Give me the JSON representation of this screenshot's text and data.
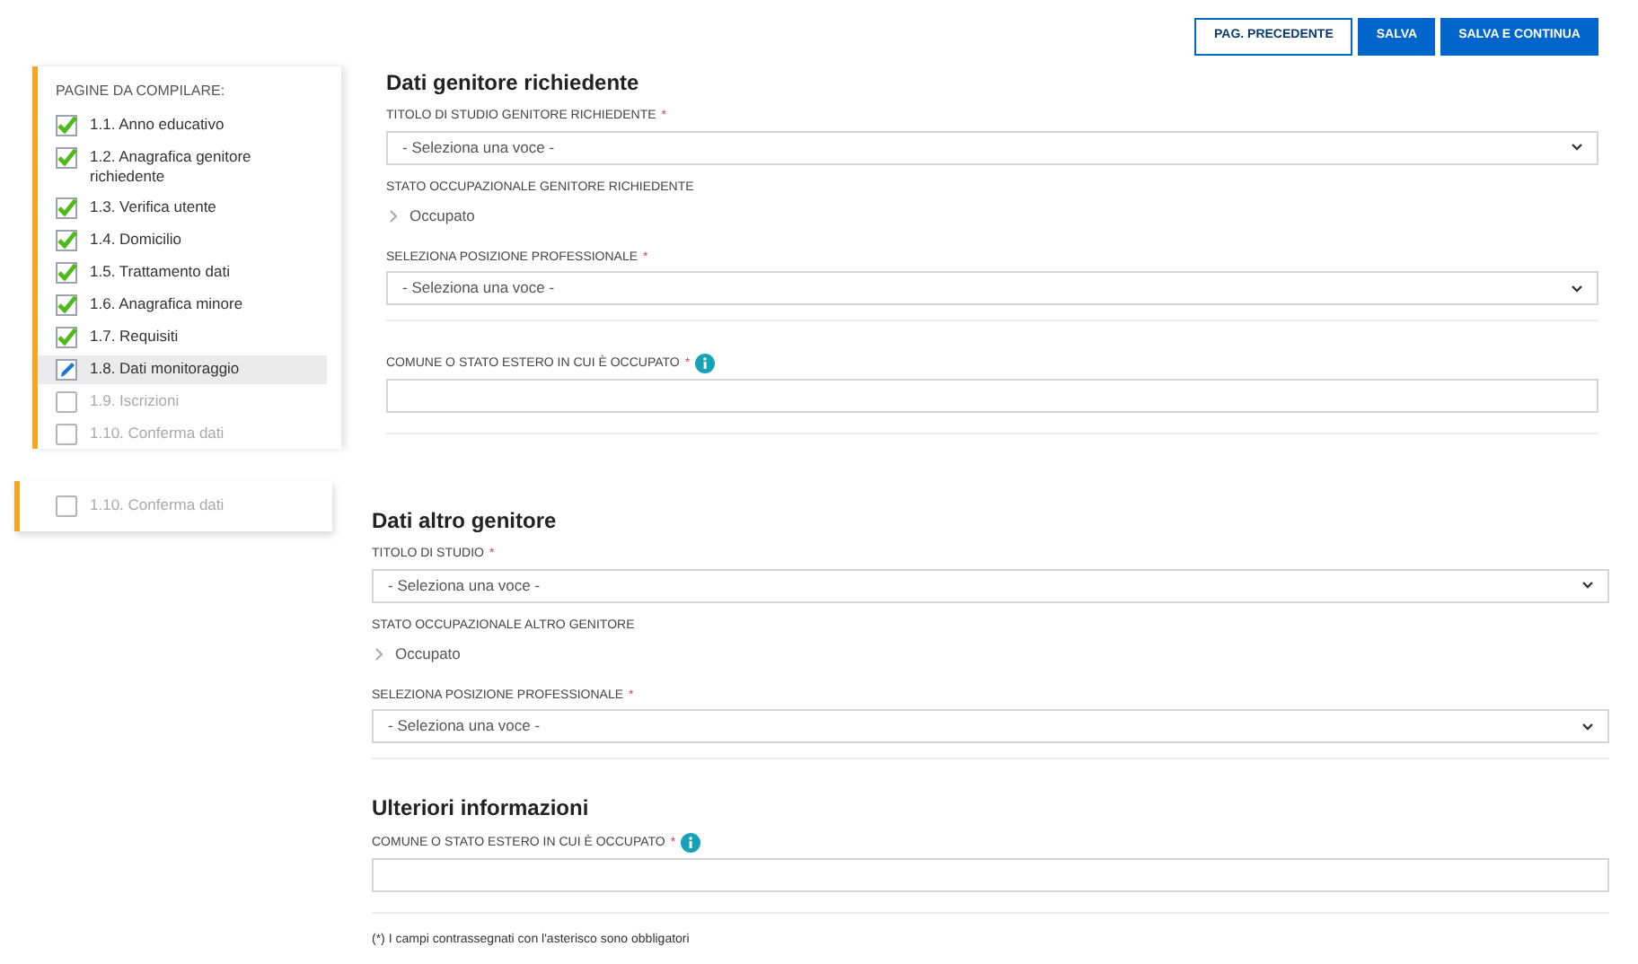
{
  "buttons": [
    {
      "label": "PAG. PRECEDENTE",
      "kind": "outline"
    },
    {
      "label": "SALVA",
      "kind": "primary"
    },
    {
      "label": "SALVA E CONTINUA",
      "kind": "primary"
    }
  ],
  "sidebar": {
    "title": "PAGINE DA COMPILARE:",
    "items": [
      {
        "label": "1.1. Anno educativo",
        "checked": true,
        "selected": false
      },
      {
        "label": "1.2. Anagrafica genitore richiedente",
        "checked": true,
        "selected": false
      },
      {
        "label": "1.3. Verifica utente",
        "checked": true,
        "selected": false
      },
      {
        "label": "1.4. Domicilio",
        "checked": true,
        "selected": false
      },
      {
        "label": "1.5. Trattamento dati",
        "checked": true,
        "selected": false
      },
      {
        "label": "1.6. Anagrafica minore",
        "checked": true,
        "selected": false
      },
      {
        "label": "1.7. Requisiti",
        "checked": true,
        "selected": false
      },
      {
        "label": "1.8. Dati monitoraggio",
        "selected": true
      },
      {
        "label": "1.9. Iscrizioni",
        "checked": false,
        "selected": false
      },
      {
        "label": "1.10. Conferma dati",
        "checked": false,
        "selected": false
      }
    ]
  },
  "sidebar_fragment": {
    "items": [
      {
        "label": "1.10. Conferma dati",
        "checked": false,
        "selected": false
      }
    ]
  },
  "section_1": {
    "title": "Dati genitore richiedente",
    "fields": [
      {
        "kind": "select",
        "label": "TITOLO DI STUDIO GENITORE RICHIEDENTE",
        "required_mark": "*",
        "value": "- Seleziona una voce -"
      },
      {
        "kind": "readonly",
        "label": "STATO OCCUPAZIONALE GENITORE RICHIEDENTE",
        "value": "Occupato"
      },
      {
        "kind": "select",
        "label": "SELEZIONA POSIZIONE PROFESSIONALE",
        "required_mark": "*",
        "value": "- Seleziona una voce -"
      },
      {
        "kind": "divider"
      },
      {
        "kind": "text",
        "label": "COMUNE O STATO ESTERO IN CUI È OCCUPATO",
        "required_mark": "*",
        "info": true
      },
      {
        "kind": "divider"
      }
    ]
  },
  "section_2": {
    "title": "Dati altro genitore",
    "fields": [
      {
        "kind": "select",
        "label": "TITOLO DI STUDIO",
        "required_mark": "*",
        "value": "- Seleziona una voce -"
      },
      {
        "kind": "readonly",
        "label": "STATO OCCUPAZIONALE ALTRO GENITORE",
        "value": "Occupato"
      },
      {
        "kind": "select",
        "label": "SELEZIONA POSIZIONE PROFESSIONALE",
        "required_mark": "*",
        "value": "- Seleziona una voce -"
      },
      {
        "kind": "divider"
      }
    ]
  },
  "section_3": {
    "title": "Ulteriori informazioni",
    "fields": [
      {
        "kind": "text",
        "label": "COMUNE O STATO ESTERO IN CUI È OCCUPATO",
        "required_mark": "*",
        "info": true
      },
      {
        "kind": "divider"
      }
    ]
  },
  "footnote": "(*) I campi contrassegnati con l'asterisco sono obbligatori"
}
